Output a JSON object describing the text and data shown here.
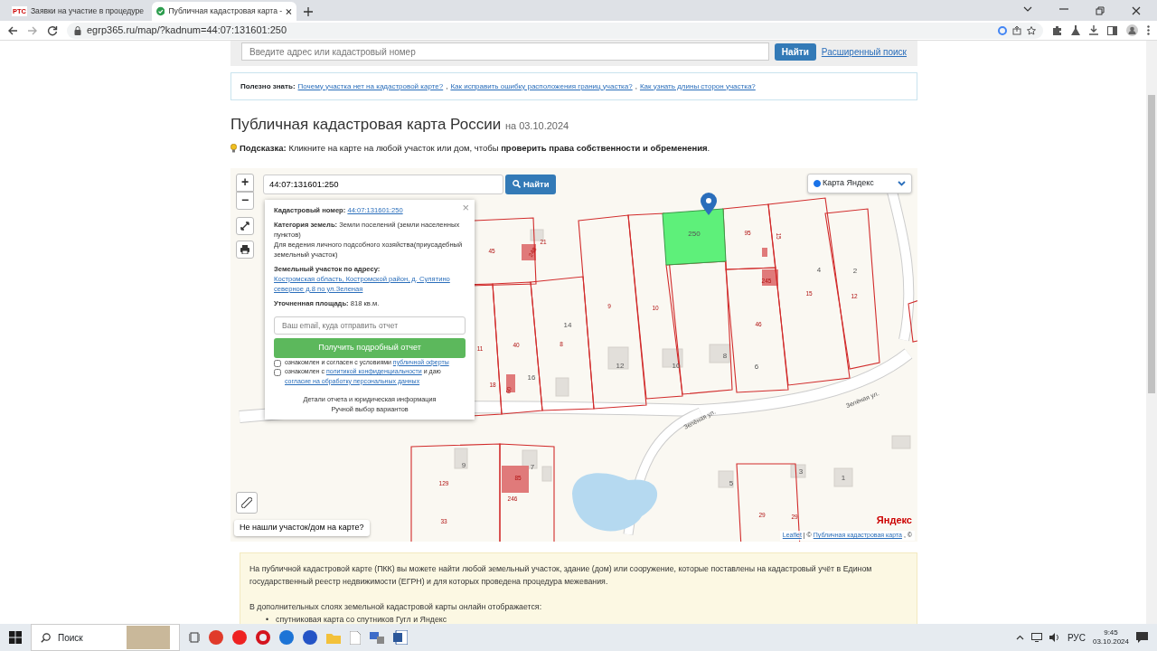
{
  "browser": {
    "tabs": [
      {
        "title": "Заявки на участие в процедуре",
        "favicon": "РТС",
        "selected": false
      },
      {
        "title": "Публичная кадастровая карта -",
        "selected": true
      }
    ],
    "url": "egrp365.ru/map/?kadnum=44:07:131601:250"
  },
  "search_bar": {
    "placeholder": "Введите адрес или кадастровый номер",
    "button": "Найти",
    "advanced_link": "Расширенный поиск"
  },
  "useful": {
    "label": "Полезно знать:",
    "separator": ",",
    "links": [
      "Почему участка нет на кадастровой карте?",
      "Как исправить ошибку расположения границ участка?",
      "Как узнать длины сторон участка?"
    ]
  },
  "heading": {
    "title": "Публичная кадастровая карта России",
    "date": "на 03.10.2024"
  },
  "hint": {
    "text": "**Подсказка:** Кликните на карте на любой участок или дом, чтобы **проверить права собственности и обременения**."
  },
  "map": {
    "zoom_in": "+",
    "zoom_out": "−",
    "search_value": "44:07:131601:250",
    "search_button": "Найти",
    "layer": {
      "label": "Карта Яндекс",
      "selected": true
    },
    "labels": [
      "45",
      "21",
      "248",
      "14",
      "8",
      "40",
      "11",
      "16",
      "18",
      "60",
      "250",
      "95",
      "15",
      "4",
      "2",
      "245",
      "15",
      "12",
      "46",
      "9",
      "10",
      "12",
      "10",
      "8",
      "6",
      "9",
      "129",
      "7",
      "85",
      "246",
      "33",
      "5",
      "3",
      "1",
      "29",
      "29"
    ],
    "streets": [
      "Зелёная ул.",
      "Зелёная ул."
    ],
    "logo": "Яндекс",
    "attribution": {
      "leaflet": "Leaflet",
      "separator": "| ©",
      "link": "Публичная кадастровая карта",
      "tail": ", ©"
    },
    "not_found": "Не нашли участок/дом на карте?",
    "popup": {
      "close": "×",
      "fields": [
        {
          "label": "Кадастровый номер:",
          "value": "44:07:131601:250",
          "kind": "link"
        },
        {
          "label": "Категория земель:",
          "value": "Земли поселений (земли населенных пунктов)",
          "kind": "text"
        }
      ],
      "usage": "Для ведения личного подсобного хозяйства(приусадебный земельный участок)",
      "fields2": [
        {
          "label": "Земельный участок по адресу:",
          "value": "Костромская область, Костромской район, д. Сулятино северное д.8 по ул.Зеленая",
          "kind": "link"
        },
        {
          "label": "Уточненная площадь:",
          "value": "818 кв.м.",
          "kind": "text"
        }
      ],
      "email_placeholder": "Ваш email, куда отправить отчет",
      "submit": "Получить подробный отчет",
      "agreements": [
        {
          "checked": false,
          "parts": [
            {
              "text": "ознакомлен и согласен с условиями",
              "link": false
            },
            {
              "text": "публичной оферты",
              "link": true
            }
          ]
        },
        {
          "checked": false,
          "parts": [
            {
              "text": "ознакомлен с",
              "link": false
            },
            {
              "text": "политикой конфиденциальности",
              "link": true
            },
            {
              "text": "и даю",
              "link": false
            },
            {
              "text": "согласие на обработку персональных данных",
              "link": true
            }
          ]
        }
      ],
      "links": [
        "Детали отчета и юридическая информация",
        "Ручной выбор вариантов"
      ]
    }
  },
  "info": {
    "paragraph": "На публичной кадастровой карте (ПКК) вы можете найти любой земельный участок, здание (дом) или сооружение, которые поставлены на кадастровый учёт в Едином государственный реестр недвижимости (ЕГРН) и для которых проведена процедура межевания.",
    "layers_intro": "В дополнительных слоях земельной кадастровой карты онлайн отображается:",
    "bullet": "•",
    "layers": [
      "спутниковая карта со спутников Гугл и Яндекс"
    ]
  },
  "taskbar": {
    "search": "Поиск",
    "lang": "РУС",
    "time": "9:45",
    "date": "03.10.2024"
  }
}
